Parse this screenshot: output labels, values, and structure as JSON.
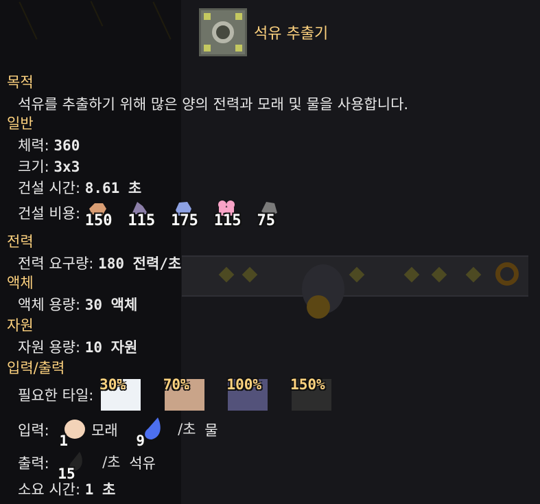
{
  "block": {
    "name": "석유 추출기",
    "icon": "oil-extractor-icon"
  },
  "sections": {
    "purpose": {
      "title": "목적",
      "text": "석유를 추출하기 위해 많은 양의 전력과 모래 및 물을 사용합니다."
    },
    "general": {
      "title": "일반",
      "health_label": "체력:",
      "health_value": "360",
      "size_label": "크기:",
      "size_value": "3x3",
      "build_time_label": "건설 시간:",
      "build_time_value": "8.61 초",
      "build_cost_label": "건설 비용:",
      "build_cost": [
        {
          "icon": "copper-item-icon",
          "color": "#d99d73",
          "amount": "150"
        },
        {
          "icon": "lead-item-icon",
          "color": "#8c7fa9",
          "amount": "115"
        },
        {
          "icon": "titanium-item-icon",
          "color": "#8da1e3",
          "amount": "175"
        },
        {
          "icon": "thorium-item-icon",
          "color": "#f9a3c7",
          "amount": "115"
        },
        {
          "icon": "silicon-item-icon",
          "color": "#7a7a7a",
          "amount": "75"
        }
      ]
    },
    "power": {
      "title": "전력",
      "usage_label": "전력 요구량:",
      "usage_value": "180 전력/초"
    },
    "liquid": {
      "title": "액체",
      "capacity_label": "액체 용량:",
      "capacity_value": "30 액체"
    },
    "items": {
      "title": "자원",
      "capacity_label": "자원 용량:",
      "capacity_value": "10 자원"
    },
    "io": {
      "title": "입력/출력",
      "tiles_label": "필요한 타일:",
      "tiles": [
        {
          "percent": "30%",
          "color": "#eef2f6",
          "name": "salt-tile"
        },
        {
          "percent": "70%",
          "color": "#c9a489",
          "name": "sand-tile"
        },
        {
          "percent": "100%",
          "color": "#53527a",
          "name": "shale-tile"
        },
        {
          "percent": "150%",
          "color": "#2d2d2d",
          "name": "dark-sand-tile"
        }
      ],
      "input_label": "입력:",
      "input_sand_amount": "1",
      "input_sand_name": "모래",
      "input_water_amount": "9",
      "input_water_unit": "/초",
      "input_water_name": "물",
      "output_label": "출력:",
      "output_oil_amount": "15",
      "output_oil_unit": "/초",
      "output_oil_name": "석유",
      "craft_time_label": "소요 시간:",
      "craft_time_value": "1 초"
    }
  },
  "colors": {
    "accent": "#ffd37f",
    "text": "#e9e9e9",
    "background": "#17171b"
  }
}
